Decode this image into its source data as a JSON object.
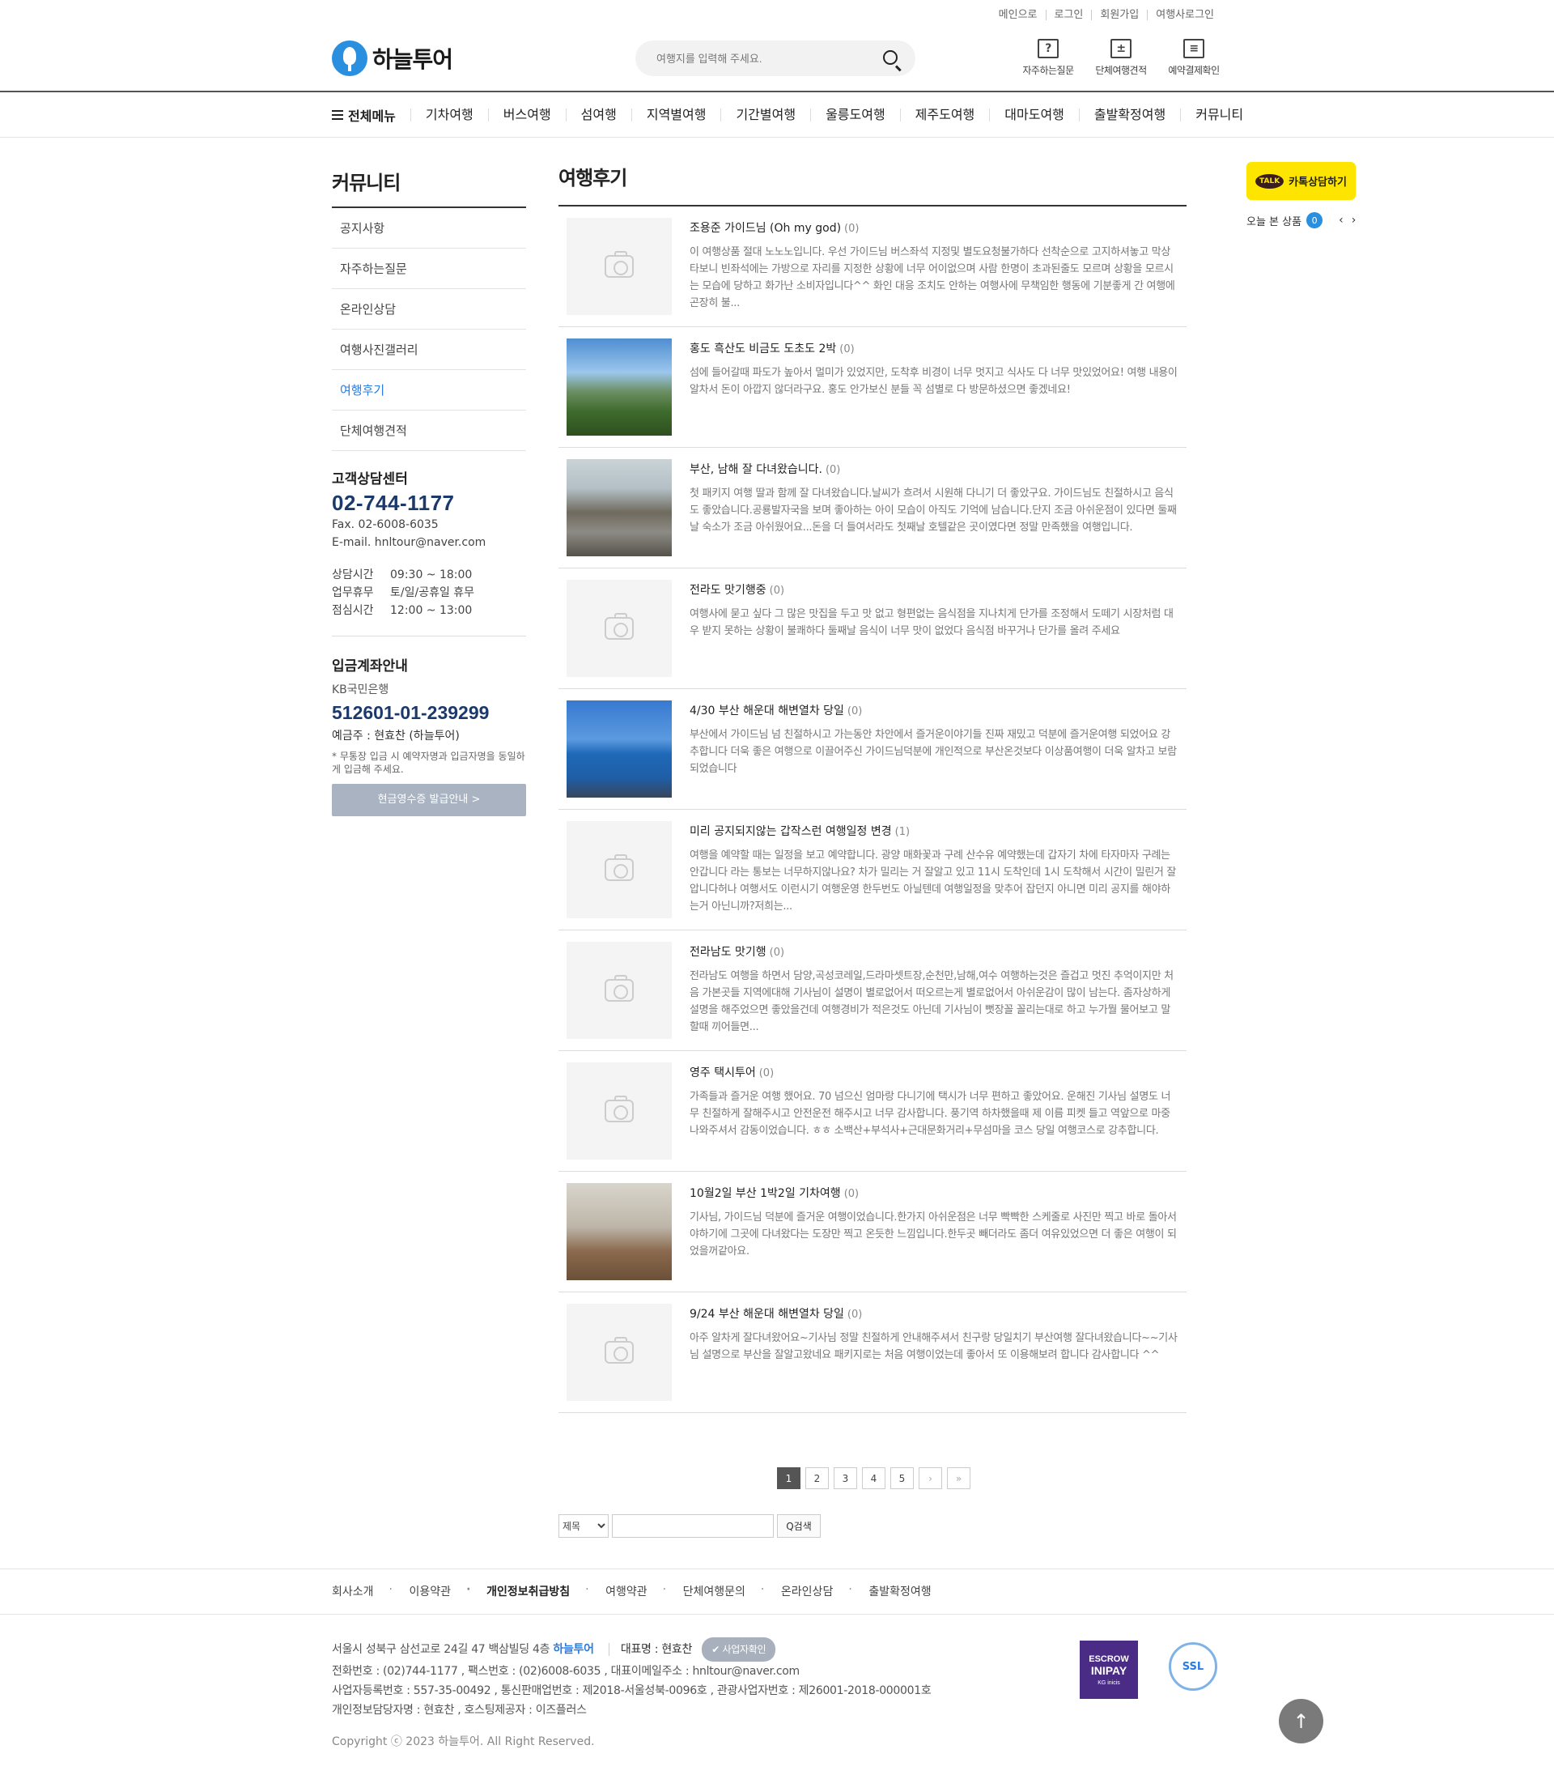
{
  "util_links": [
    "메인으로",
    "로그인",
    "회원가입",
    "여행사로그인"
  ],
  "logo_text": "하늘투어",
  "search": {
    "placeholder": "여행지를 입력해 주세요."
  },
  "quick_links": [
    {
      "label": "자주하는질문",
      "icon": "question-icon",
      "glyph": "?"
    },
    {
      "label": "단체여행견적",
      "icon": "calculator-icon",
      "glyph": "±"
    },
    {
      "label": "예약결제확인",
      "icon": "receipt-icon",
      "glyph": "≡"
    }
  ],
  "gnb": {
    "all_menu": "전체메뉴",
    "items": [
      "기차여행",
      "버스여행",
      "섬여행",
      "지역별여행",
      "기간별여행",
      "울릉도여행",
      "제주도여행",
      "대마도여행",
      "출발확정여행",
      "커뮤니티"
    ]
  },
  "sidebar": {
    "title": "커뮤니티",
    "items": [
      "공지사항",
      "자주하는질문",
      "온라인상담",
      "여행사진갤러리",
      "여행후기",
      "단체여행견적"
    ],
    "active_index": 4
  },
  "cs": {
    "title": "고객상담센터",
    "tel": "02-744-1177",
    "fax": "Fax. 02-6008-6035",
    "email": "E-mail. hnltour@naver.com",
    "hours": [
      {
        "k": "상담시간",
        "v": "09:30 ~ 18:00"
      },
      {
        "k": "업무휴무",
        "v": "토/일/공휴일 휴무"
      },
      {
        "k": "점심시간",
        "v": "12:00 ~ 13:00"
      }
    ]
  },
  "bank": {
    "title": "입금계좌안내",
    "bank_name": "KB국민은행",
    "account": "512601-01-239299",
    "owner": "예금주 : 현효찬 (하늘투어)",
    "note": "* 무통장 입금 시 예약자명과 입금자명을 동일하게 입금해 주세요.",
    "button": "현금영수증 발급안내 >"
  },
  "board": {
    "title": "여행후기",
    "posts": [
      {
        "title": "조용준 가이드님 (Oh my god)",
        "count": "(0)",
        "photo": "",
        "desc": "이 여행상품 절대 노노노입니다. 우선 가이드님 버스좌석 지정및 별도요청불가하다 선착순으로 고지하셔놓고 막상 타보니 빈좌석에는 가방으로 자리를 지정한 상황에 너무 어이없으며 사람 한명이 초과된줄도 모르며 상황을 모르시는 모습에 당하고 화가난 소비자입니다^^ 화인 대응 조치도 안하는 여행사에 무책임한 행동에 기분좋게 간 여행에 곤장히 불..."
      },
      {
        "title": "홍도 흑산도 비금도 도초도 2박",
        "count": "(0)",
        "photo": "p1",
        "desc": "섬에 들어갈때 파도가 높아서 멀미가 있었지만, 도착후 비경이 너무 멋지고 식사도 다 너무 맛있었어요! 여행 내용이 알차서 돈이 아깝지 않더라구요. 홍도 안가보신 분들 꼭 섬별로 다 방문하셨으면 좋겠네요!"
      },
      {
        "title": "부산, 남해 잘 다녀왔습니다.",
        "count": "(0)",
        "photo": "p2",
        "desc": "첫 패키지 여행 딸과 함께 잘 다녀왔습니다.날씨가 흐려서 시원해 다니기 더 좋았구요. 가이드님도 친절하시고 음식도 좋았습니다.공룡발자국을 보며 좋아하는 아이 모습이 아직도 기억에 남습니다.단지 조금 아쉬운점이 있다면 둘째날 숙소가 조금 아쉬웠어요...돈을 더 들여서라도 첫째날 호텔같은 곳이였다면 정말 만족했을 여행입니다."
      },
      {
        "title": "전라도 맛기행중",
        "count": "(0)",
        "photo": "",
        "desc": "여행사에 묻고 싶다 그 많은 맛집을 두고 맛 없고 형편없는 음식점을 지나치게 단가를 조정해서 도떼기 시장처럼 대우 받지 못하는 상황이 불쾌하다 둘째날 음식이 너무 맛이 없었다 음식점 바꾸거나 단가를 올려 주세요"
      },
      {
        "title": "4/30 부산 해운대 해변열차 당일",
        "count": "(0)",
        "photo": "p3",
        "desc": "부산에서 가이드님 넘 친절하시고 가는동안 차안에서 즐거운이야기들 진짜 재밌고 덕분에 즐거운여행 되었어요 강추합니다 더욱 좋은 여행으로 이끌어주신 가이드님덕분에 개인적으로 부산온것보다 이상품여행이 더욱 알차고 보람되었습니다"
      },
      {
        "title": "미리 공지되지않는 갑작스런 여행일정 변경",
        "count": "(1)",
        "photo": "",
        "desc": "여행을 예약할 때는 일정을 보고 예약합니다. 광양 매화꽃과 구례 산수유 예약했는데 갑자기 차에 타자마자 구례는 안갑니다 라는 통보는 너무하지않나요? 차가 밀리는 거 잘알고 있고 11시 도착인데 1시 도착해서 시간이 밀린거 잘압니다허나 여행서도 이런시기 여행운영 한두번도 아닐텐데 여행일정을 맞추어 잡던지 아니면 미리 공지를 해야하는거 아닌니까?저희는..."
      },
      {
        "title": "전라남도 맛기행",
        "count": "(0)",
        "photo": "",
        "desc": "전라남도 여행을 하면서 담양,곡성코레일,드라마셋트장,순천만,남해,여수 여행하는것은 즐겁고 멋진 추억이지만 처음 가본곳들 지역에대해 기사님이 설명이 별로없어서 떠오르는게 별로없어서 아쉬운감이 많이 남는다. 좀자상하게 설명을 해주었으면 좋았을건데 여행경비가 적은것도 아닌데 기사님이 뻣장꼴 꼴리는대로 하고 누가뭘 물어보고 말할때 끼어들면..."
      },
      {
        "title": "영주 택시투어",
        "count": "(0)",
        "photo": "",
        "desc": "가족들과 즐거운 여행 했어요. 70 넘으신 엄마랑 다니기에 택시가 너무 편하고 좋았어요. 운해진 기사님 설명도 너무 친절하게 잘해주시고 안전운전 해주시고 너무 감사합니다. 풍기역 하차했을때 제 이름 피켓 들고 역앞으로 마중 나와주셔서 감동이었습니다. ㅎㅎ 소백산+부석사+근대문화거리+무섬마을 코스 당일 여행코스로 강추합니다."
      },
      {
        "title": "10월2일 부산 1박2일 기차여행",
        "count": "(0)",
        "photo": "p4",
        "desc": "기사님, 가이드님 덕분에 즐거운 여행이었습니다.한가지 아쉬운점은 너무 빡빡한 스케줄로 사진만 찍고 바로 돌아서야하기에 그곳에 다녀왔다는 도장만 찍고 온듯한 느낌입니다.한두곳 빼더라도 좀더 여유있었으면 더 좋은 여행이 되었을꺼같아요."
      },
      {
        "title": "9/24 부산 해운대 해변열차 당일",
        "count": "(0)",
        "photo": "",
        "desc": "아주 알차게 잘다녀왔어요~기사님 정말 친절하게 안내해주셔서 친구랑 당일치기 부산여행 잘다녀왔습니다~~기사님 설명으로 부산을 잘알고왔네요 패키지로는 처음 여행이었는데 좋아서 또 이용해보려 합니다 감사합니다 ^^"
      }
    ]
  },
  "pager": {
    "pages": [
      "1",
      "2",
      "3",
      "4",
      "5"
    ],
    "current": "1",
    "next": "›",
    "last": "»"
  },
  "board_search": {
    "select": "제목",
    "button": "Q검색"
  },
  "kakao": {
    "talk": "TALK",
    "label": "카톡상담하기"
  },
  "today": {
    "label": "오늘 본 상품",
    "count": "0",
    "prev": "‹",
    "next": "›"
  },
  "footer": {
    "nav": [
      "회사소개",
      "이용약관",
      "개인정보취급방침",
      "여행약관",
      "단체여행문의",
      "온라인상담",
      "출발확정여행"
    ],
    "address": "서울시 성북구 삼선교로 24길 47 백삼빌딩 4층",
    "brand": "하늘투어",
    "ceo": "대표명 : 현효찬",
    "verify": "사업자확인",
    "line2": "전화번호 : (02)744-1177 , 팩스번호 : (02)6008-6035 , 대표이메일주소 : hnltour@naver.com",
    "line3": "사업자등록번호 : 557-35-00492 , 통신판매업번호 : 제2018-서울성북-0096호 , 관광사업자번호 : 제26001-2018-000001호",
    "line4": "개인정보담당자명 : 현효찬 , 호스팅제공자 : 이즈플러스",
    "copyright": "Copyright ⓒ 2023 하늘투어. All Right Reserved.",
    "escrow": [
      "ESCROW",
      "INIPAY",
      "KG inicis"
    ],
    "ssl": "SSL"
  }
}
